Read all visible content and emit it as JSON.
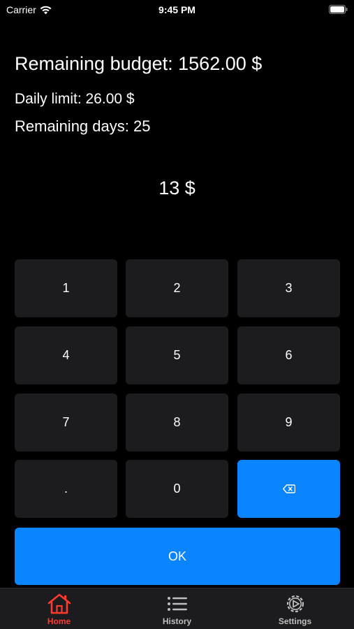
{
  "status_bar": {
    "carrier": "Carrier",
    "time": "9:45 PM"
  },
  "info": {
    "remaining_budget": "Remaining budget: 1562.00 $",
    "daily_limit": "Daily limit: 26.00 $",
    "remaining_days": "Remaining days: 25"
  },
  "amount_display": "13 $",
  "keypad": {
    "k1": "1",
    "k2": "2",
    "k3": "3",
    "k4": "4",
    "k5": "5",
    "k6": "6",
    "k7": "7",
    "k8": "8",
    "k9": "9",
    "dot": ".",
    "k0": "0",
    "backspace_icon": "backspace-icon"
  },
  "ok_label": "OK",
  "tabs": [
    {
      "label": "Home",
      "icon": "house-icon",
      "active": true
    },
    {
      "label": "History",
      "icon": "list-icon",
      "active": false
    },
    {
      "label": "Settings",
      "icon": "gear-icon",
      "active": false
    }
  ],
  "colors": {
    "background": "#000000",
    "key": "#1c1c1e",
    "accent_blue": "#0a84ff",
    "active_tab": "#ff3b30"
  }
}
